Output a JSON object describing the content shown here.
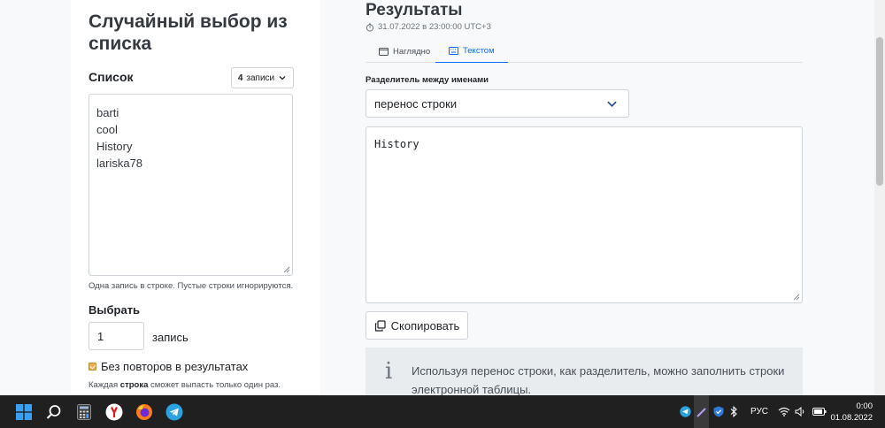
{
  "left_panel": {
    "title": "Случайный выбор из списка",
    "list_label": "Список",
    "records_count": "4",
    "records_word": "записи",
    "items": [
      "barti",
      "cool",
      "History",
      "lariska78"
    ],
    "list_help": "Одна запись в строке. Пустые строки игнорируются.",
    "choose_label": "Выбрать",
    "choose_value": "1",
    "choose_unit": "запись",
    "no_repeats_label": "Без повторов в результатах",
    "no_repeats_help_pre": "Каждая ",
    "no_repeats_help_bold": "строка",
    "no_repeats_help_post": " сможет выпасть только один раз.",
    "no_repeats_checked": true
  },
  "results": {
    "title": "Результаты",
    "timestamp": "31.07.2022 в 23:00:00 UTC+3",
    "tabs": [
      {
        "label": "Наглядно",
        "active": false,
        "icon": "window-icon"
      },
      {
        "label": "Текстом",
        "active": true,
        "icon": "keyboard-icon"
      }
    ],
    "separator_label": "Разделитель между именами",
    "separator_value": "перенос строки",
    "output_text": "History",
    "copy_label": "Скопировать",
    "info_text": "Используя перенос строки, как разделитель, можно заполнить строки электронной таблицы."
  },
  "taskbar": {
    "pinned": [
      "windows-start-icon",
      "search-icon",
      "calculator-icon",
      "yandex-browser-icon",
      "firefox-icon",
      "telegram-icon"
    ],
    "tray_icons": [
      "telegram-tray-icon",
      "pen-tray-icon",
      "defender-tray-icon",
      "bluetooth-icon"
    ],
    "language": "РУС",
    "time": "0:00",
    "date": "01.08.2022"
  },
  "colors": {
    "accent": "#0d6efd",
    "checkbox": "#f0ad4e",
    "taskbar": "#202020"
  }
}
